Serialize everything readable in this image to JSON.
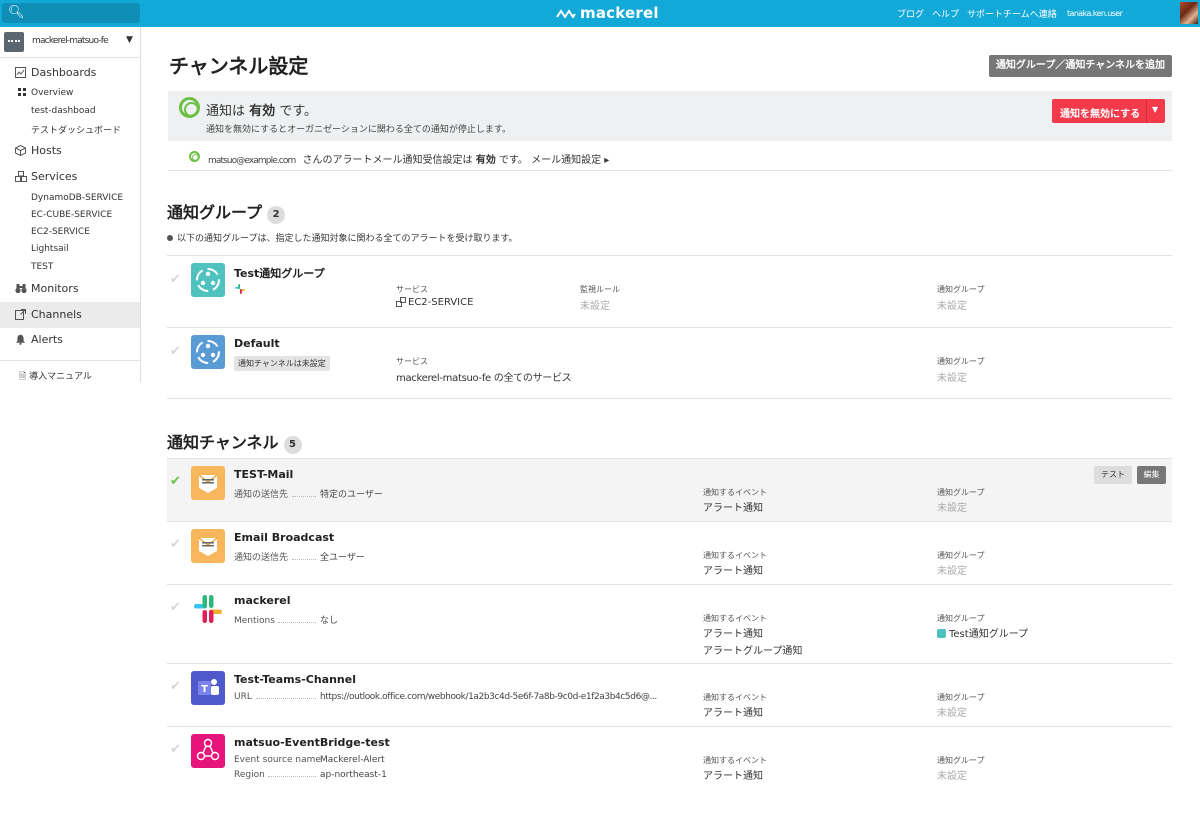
{
  "topbar": {
    "logo": "mackerel",
    "links": [
      "ブログ",
      "ヘルプ",
      "サポートチームへ連絡"
    ],
    "user_name": "tanaka.ken.user"
  },
  "sidebar": {
    "org_name": "mackerel-matsuo-fe",
    "dashboards": "Dashboards",
    "dashboard_items": [
      "Overview",
      "test-dashboad",
      "テストダッシュボード"
    ],
    "hosts": "Hosts",
    "services": "Services",
    "service_items": [
      "DynamoDB-SERVICE",
      "EC-CUBE-SERVICE",
      "EC2-SERVICE",
      "Lightsail",
      "TEST"
    ],
    "monitors": "Monitors",
    "channels": "Channels",
    "alerts": "Alerts",
    "manual": "導入マニュアル"
  },
  "page": {
    "title": "チャンネル設定",
    "add_button": "通知グループ／通知チャンネルを追加"
  },
  "status": {
    "prefix": "通知は",
    "state": "有効",
    "suffix": "です。",
    "sub": "通知を無効にするとオーガニゼーションに関わる全ての通知が停止します。",
    "disable_button": "通知を無効にする",
    "mail_address": "matsuo@example.com",
    "mail_text_1": "さんのアラートメール通知受信設定は",
    "mail_state": "有効",
    "mail_text_2": "です。",
    "mail_link": "メール通知設定 ▸"
  },
  "groups": {
    "title": "通知グループ",
    "count": "2",
    "description": "以下の通知グループは、指定した通知対象に関わる全てのアラートを受け取ります。",
    "items": [
      {
        "name": "Test通知グループ",
        "service_label": "サービス",
        "service_value": "EC2-SERVICE",
        "monitor_label": "監視ルール",
        "monitor_value": "未設定",
        "group_label": "通知グループ",
        "group_value": "未設定"
      },
      {
        "name": "Default",
        "tag": "通知チャンネルは未設定",
        "service_label": "サービス",
        "service_value": "mackerel-matsuo-fe の全てのサービス",
        "group_label": "通知グループ",
        "group_value": "未設定"
      }
    ]
  },
  "channels": {
    "title": "通知チャンネル",
    "count": "5",
    "test_button": "テスト",
    "edit_button": "編集",
    "event_label": "通知するイベント",
    "group_label": "通知グループ",
    "items": [
      {
        "name": "TEST-Mail",
        "rows": [
          {
            "k": "通知の送信先",
            "v": "特定のユーザー"
          }
        ],
        "events": [
          "アラート通知"
        ],
        "group": "未設定"
      },
      {
        "name": "Email Broadcast",
        "rows": [
          {
            "k": "通知の送信先",
            "v": "全ユーザー"
          }
        ],
        "events": [
          "アラート通知"
        ],
        "group": "未設定"
      },
      {
        "name": "mackerel",
        "rows": [
          {
            "k": "Mentions",
            "v": "なし"
          }
        ],
        "events": [
          "アラート通知",
          "アラートグループ通知"
        ],
        "group": "Test通知グループ"
      },
      {
        "name": "Test-Teams-Channel",
        "rows": [
          {
            "k": "URL",
            "v": "https://outlook.office.com/webhook/1a2b3c4d-5e6f-7a8b-9c0d-e1f2a3b4c5d6@..."
          }
        ],
        "events": [
          "アラート通知"
        ],
        "group": "未設定"
      },
      {
        "name": "matsuo-EventBridge-test",
        "rows": [
          {
            "k": "Event source name",
            "v": "Mackerel-Alert"
          },
          {
            "k": "Region",
            "v": "ap-northeast-1"
          }
        ],
        "events": [
          "アラート通知"
        ],
        "group": "未設定"
      }
    ]
  },
  "colors": {
    "topbar": "#12a8d8",
    "enabled": "#6cc144",
    "danger": "#f23a4a",
    "group_tile": "#4fc2c0",
    "default_tile": "#5b9bd5",
    "mail_tile": "#f8b65d",
    "teams_tile": "#5059c9",
    "eventbridge_tile": "#e7157b"
  }
}
